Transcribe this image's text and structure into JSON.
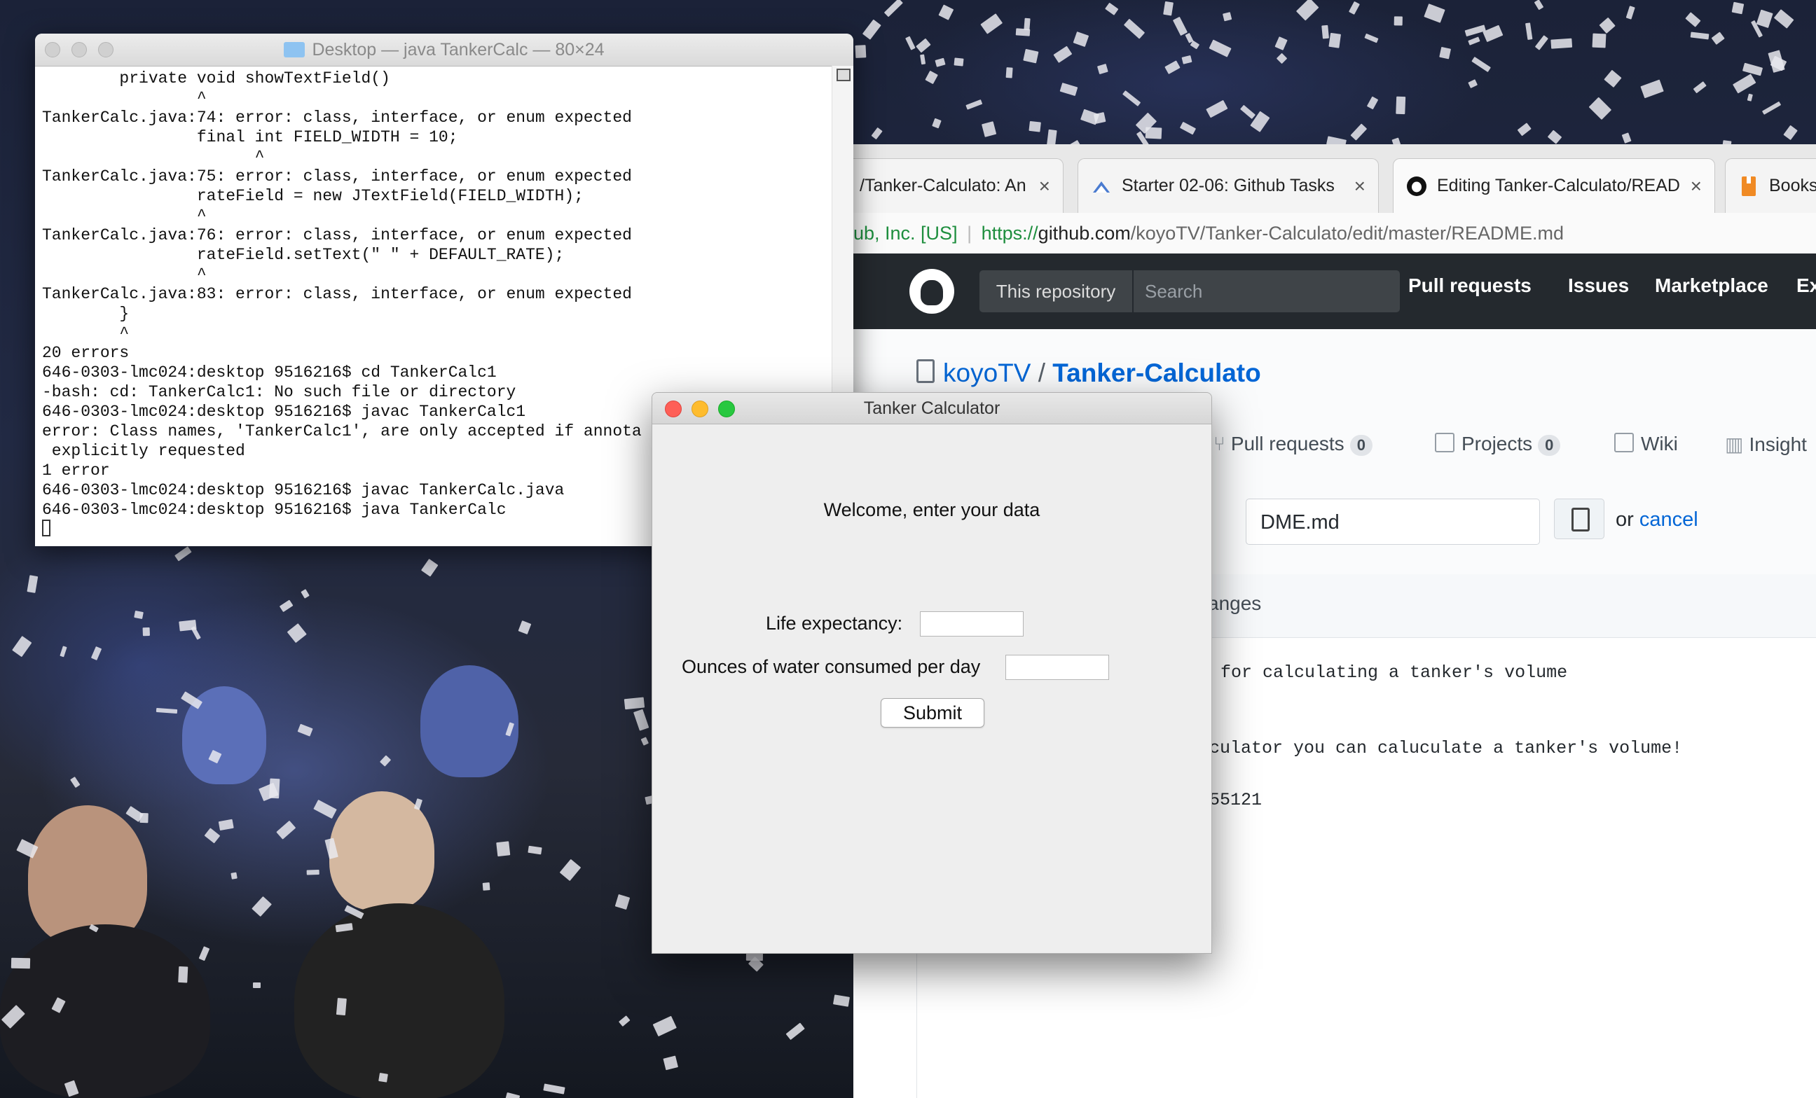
{
  "terminal": {
    "title": "Desktop — java TankerCalc — 80×24",
    "lines": [
      "        private void showTextField()",
      "                ^",
      "TankerCalc.java:74: error: class, interface, or enum expected",
      "                final int FIELD_WIDTH = 10;",
      "                      ^",
      "TankerCalc.java:75: error: class, interface, or enum expected",
      "                rateField = new JTextField(FIELD_WIDTH);",
      "                ^",
      "TankerCalc.java:76: error: class, interface, or enum expected",
      "                rateField.setText(\" \" + DEFAULT_RATE);",
      "                ^",
      "TankerCalc.java:83: error: class, interface, or enum expected",
      "        }",
      "        ^",
      "20 errors",
      "646-0303-lmc024:desktop 9516216$ cd TankerCalc1",
      "-bash: cd: TankerCalc1: No such file or directory",
      "646-0303-lmc024:desktop 9516216$ javac TankerCalc1",
      "error: Class names, 'TankerCalc1', are only accepted if annota",
      " explicitly requested",
      "1 error",
      "646-0303-lmc024:desktop 9516216$ javac TankerCalc.java",
      "646-0303-lmc024:desktop 9516216$ java TankerCalc"
    ]
  },
  "browser": {
    "tabs": [
      {
        "label": "/Tanker-Calculato: An a",
        "close": "×"
      },
      {
        "label": "Starter 02-06: Github Tasks",
        "close": "×"
      },
      {
        "label": "Editing Tanker-Calculato/READ",
        "close": "×"
      },
      {
        "label": "Booksh"
      }
    ],
    "address": {
      "secure_label": "ub, Inc. [US]",
      "scheme": "https://",
      "domain": "github.com",
      "path": "/koyoTV/Tanker-Calculato/edit/master/README.md"
    },
    "header": {
      "scope": "This repository",
      "search_placeholder": "Search",
      "nav": [
        "Pull requests",
        "Issues",
        "Marketplace",
        "Ex"
      ]
    },
    "repo": {
      "owner": "koyoTV",
      "separator": "/",
      "name": "Tanker-Calculato",
      "tabs": [
        {
          "label": "Pull requests",
          "count": "0"
        },
        {
          "label": "Projects",
          "count": "0"
        },
        {
          "label": "Wiki"
        },
        {
          "label": "Insight"
        }
      ]
    },
    "editor": {
      "filename": "DME.md",
      "or_text": "or ",
      "cancel": "cancel",
      "bar_text": "anges",
      "lines": [
        "for calculating a tanker's volume",
        "culator you can caluculate a tanker's volume!",
        "55121"
      ]
    }
  },
  "dialog": {
    "title": "Tanker Calculator",
    "welcome": "Welcome, enter your data",
    "fields": [
      {
        "label": "Life expectancy:",
        "value": ""
      },
      {
        "label": "Ounces of water consumed per day",
        "value": ""
      }
    ],
    "submit": "Submit"
  },
  "colors": {
    "github_dark": "#24292e",
    "link_blue": "#0366d6",
    "close_red": "#fe5f57",
    "minimize_yellow": "#febc2e",
    "zoom_green": "#28c840"
  }
}
